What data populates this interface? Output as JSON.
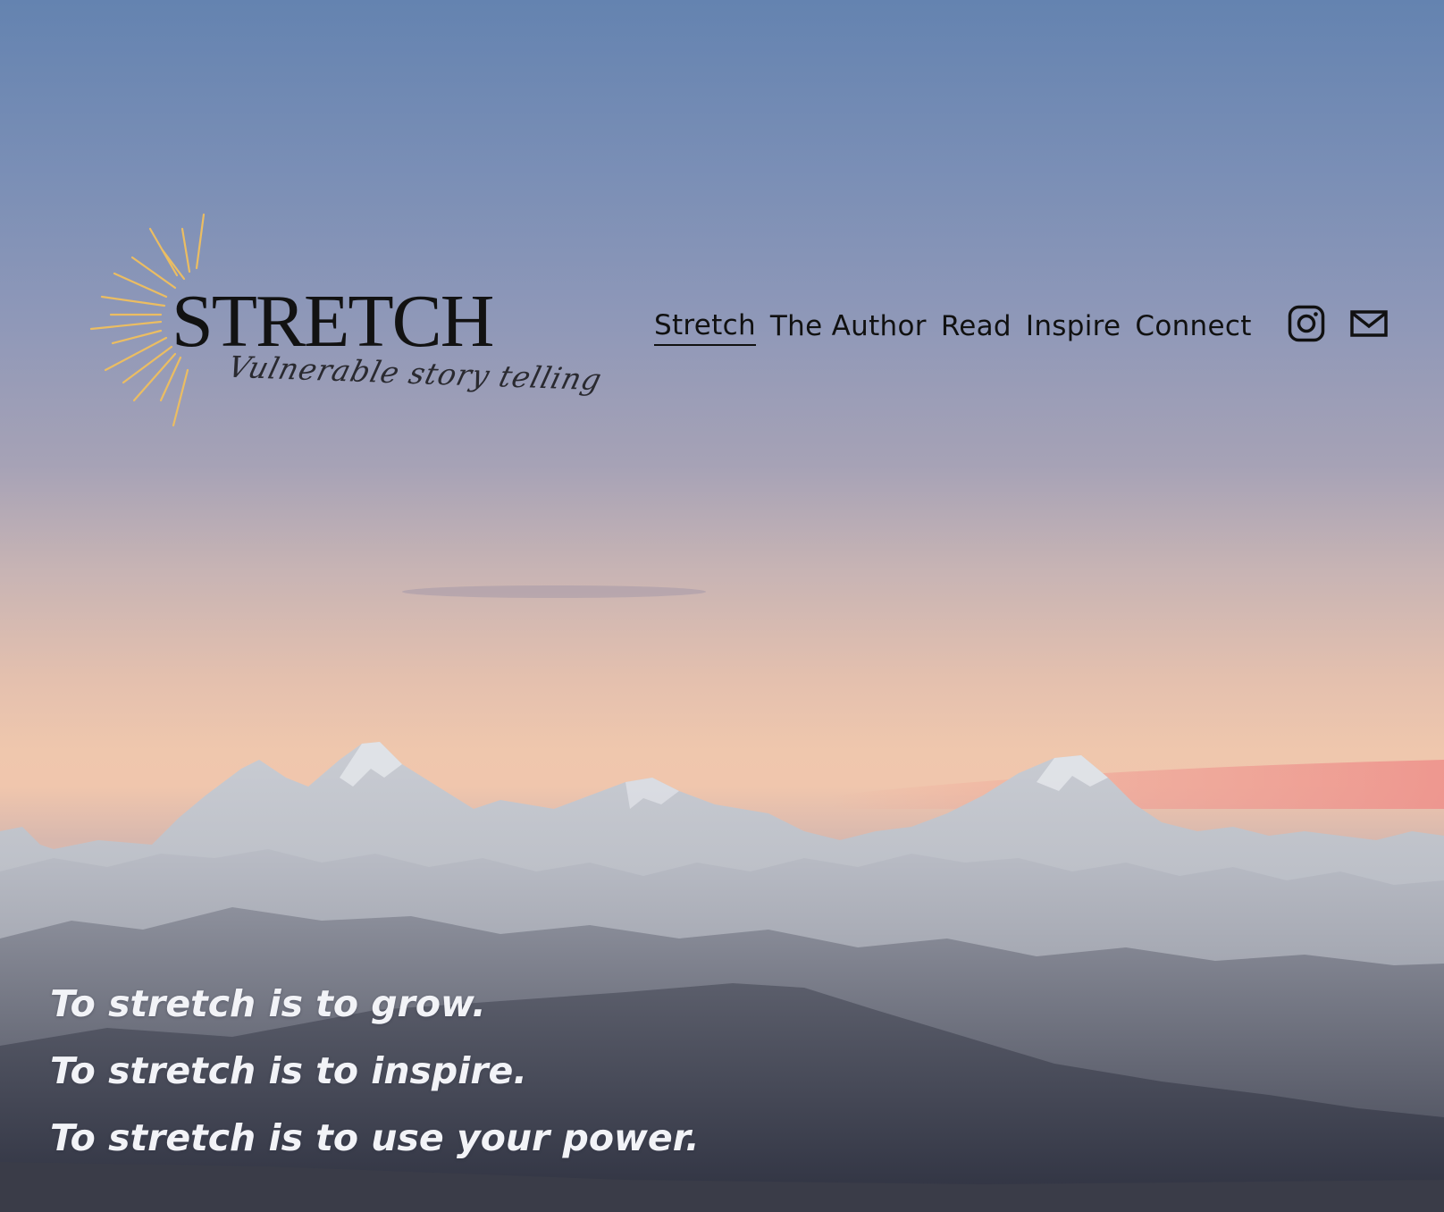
{
  "logo": {
    "wordmark": "STRETCH",
    "tagline": "Vulnerable story telling",
    "ray_color": "#ebbd62"
  },
  "nav": {
    "items": [
      {
        "label": "Stretch",
        "active": true
      },
      {
        "label": "The Author",
        "active": false
      },
      {
        "label": "Read",
        "active": false
      },
      {
        "label": "Inspire",
        "active": false
      },
      {
        "label": "Connect",
        "active": false
      }
    ]
  },
  "social": {
    "icons": [
      "instagram-icon",
      "mail-icon"
    ]
  },
  "hero": {
    "lines": [
      "To stretch is to grow.",
      "To stretch is to inspire.",
      "To stretch is to use your power."
    ]
  },
  "colors": {
    "sky_top": "#6483b0",
    "sky_horizon": "#f0c6ad",
    "text_dark": "#111111",
    "text_light": "#f2f3f7"
  }
}
